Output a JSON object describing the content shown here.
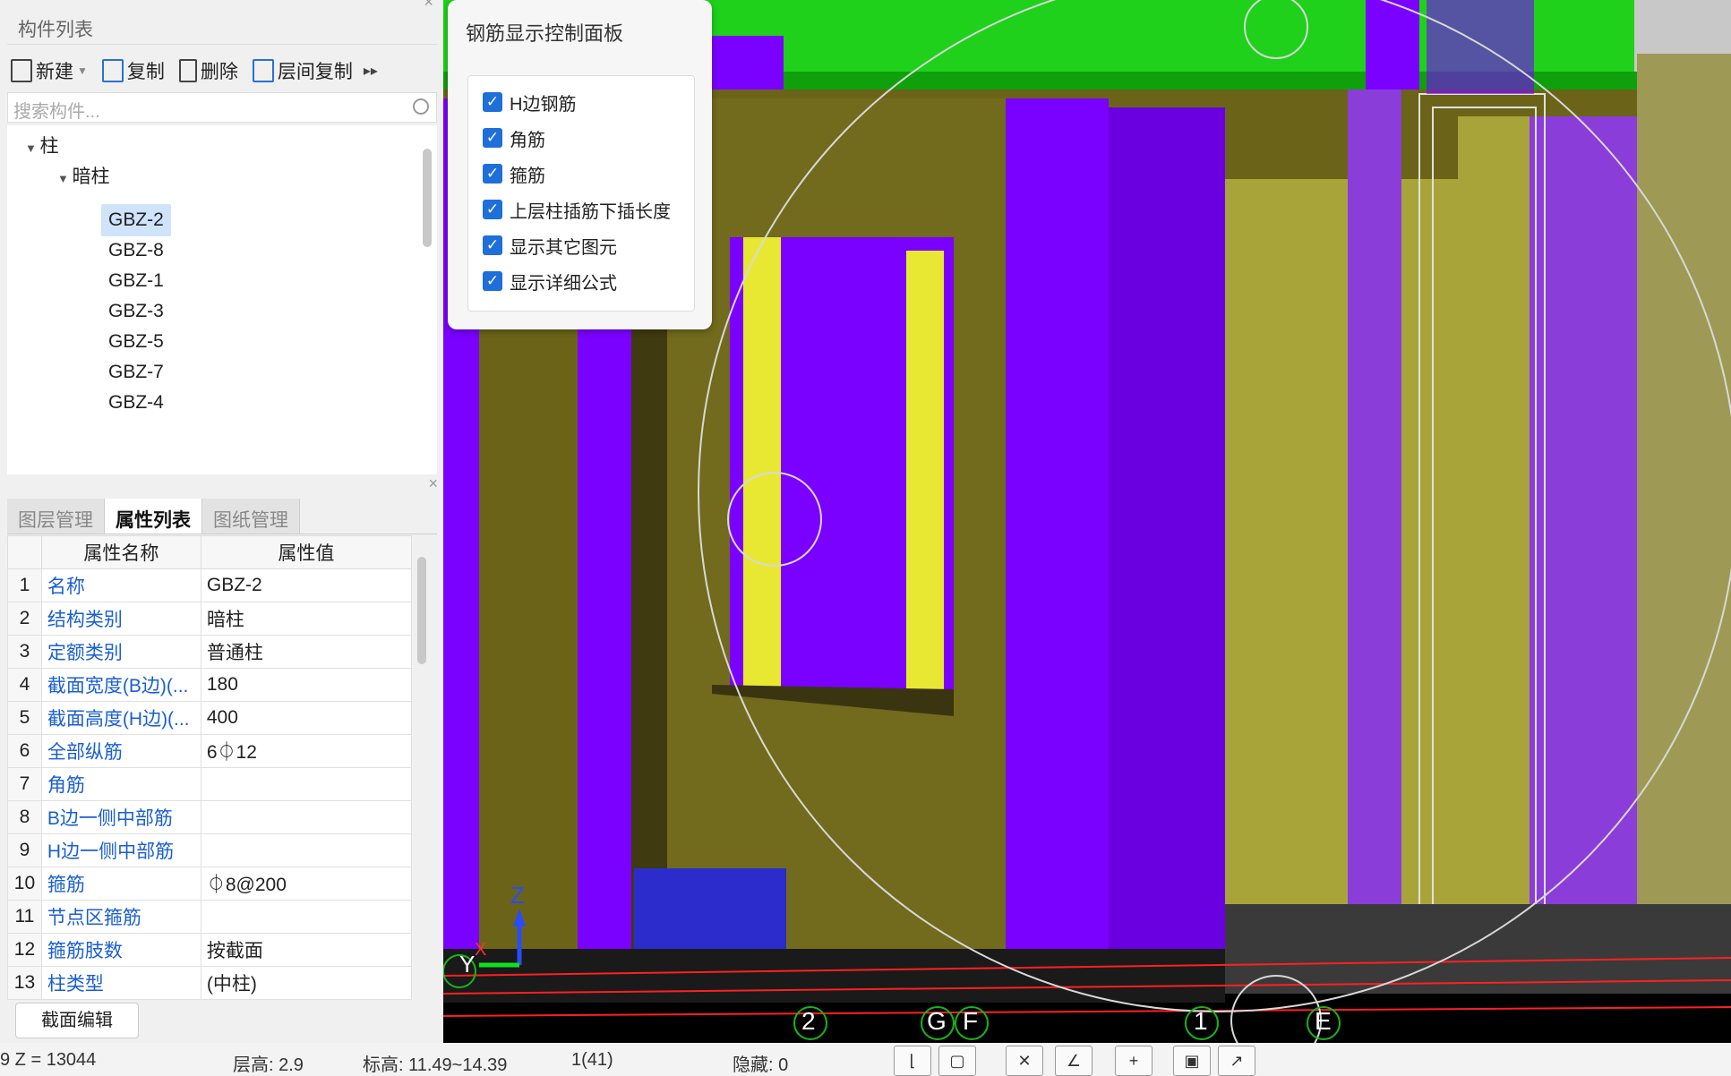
{
  "component_list": {
    "title": "构件列表",
    "toolbar": {
      "new": "新建",
      "copy": "复制",
      "delete": "删除",
      "floor_copy": "层间复制"
    },
    "search_placeholder": "搜索构件...",
    "tree": {
      "root": "柱",
      "group": "暗柱",
      "items": [
        "GBZ-2",
        "GBZ-8",
        "GBZ-1",
        "GBZ-3",
        "GBZ-5",
        "GBZ-7",
        "GBZ-4"
      ],
      "selected": "GBZ-2"
    }
  },
  "properties": {
    "tabs": [
      "图层管理",
      "属性列表",
      "图纸管理"
    ],
    "active_tab": "属性列表",
    "headers": [
      "属性名称",
      "属性值"
    ],
    "rows": [
      {
        "idx": "1",
        "name": "名称",
        "value": "GBZ-2"
      },
      {
        "idx": "2",
        "name": "结构类别",
        "value": "暗柱"
      },
      {
        "idx": "3",
        "name": "定额类别",
        "value": "普通柱"
      },
      {
        "idx": "4",
        "name": "截面宽度(B边)(...",
        "value": "180"
      },
      {
        "idx": "5",
        "name": "截面高度(H边)(...",
        "value": "400"
      },
      {
        "idx": "6",
        "name": "全部纵筋",
        "value": "6⏀12"
      },
      {
        "idx": "7",
        "name": "角筋",
        "value": ""
      },
      {
        "idx": "8",
        "name": "B边一侧中部筋",
        "value": ""
      },
      {
        "idx": "9",
        "name": "H边一侧中部筋",
        "value": ""
      },
      {
        "idx": "10",
        "name": "箍筋",
        "value": "⏀8@200"
      },
      {
        "idx": "11",
        "name": "节点区箍筋",
        "value": ""
      },
      {
        "idx": "12",
        "name": "箍筋肢数",
        "value": "按截面"
      },
      {
        "idx": "13",
        "name": "柱类型",
        "value": "(中柱)"
      }
    ],
    "edit_button": "截面编辑"
  },
  "control_panel": {
    "title": "钢筋显示控制面板",
    "options": [
      {
        "label": "H边钢筋",
        "checked": true
      },
      {
        "label": "角筋",
        "checked": true
      },
      {
        "label": "箍筋",
        "checked": true
      },
      {
        "label": "上层柱插筋下插长度",
        "checked": true
      },
      {
        "label": "显示其它图元",
        "checked": true
      },
      {
        "label": "显示详细公式",
        "checked": true
      }
    ]
  },
  "viewport": {
    "axis_labels": [
      "2",
      "G",
      "F",
      "1",
      "E"
    ],
    "gizmo": {
      "z": "Z",
      "y": "Y",
      "x": "X",
      "g": "G"
    }
  },
  "status_bar": {
    "z": "9 Z = 13044",
    "floor_height": "层高:  2.9",
    "elevation": "标高:  11.49~14.39",
    "count": "1(41)",
    "hidden": "隐藏:  0"
  },
  "colors": {
    "purple": "#7a00ff",
    "olive": "#7d7420",
    "yellow": "#e8e832",
    "green": "#25d41a",
    "blue": "#2c2ccc",
    "accent": "#1e6fd9"
  }
}
